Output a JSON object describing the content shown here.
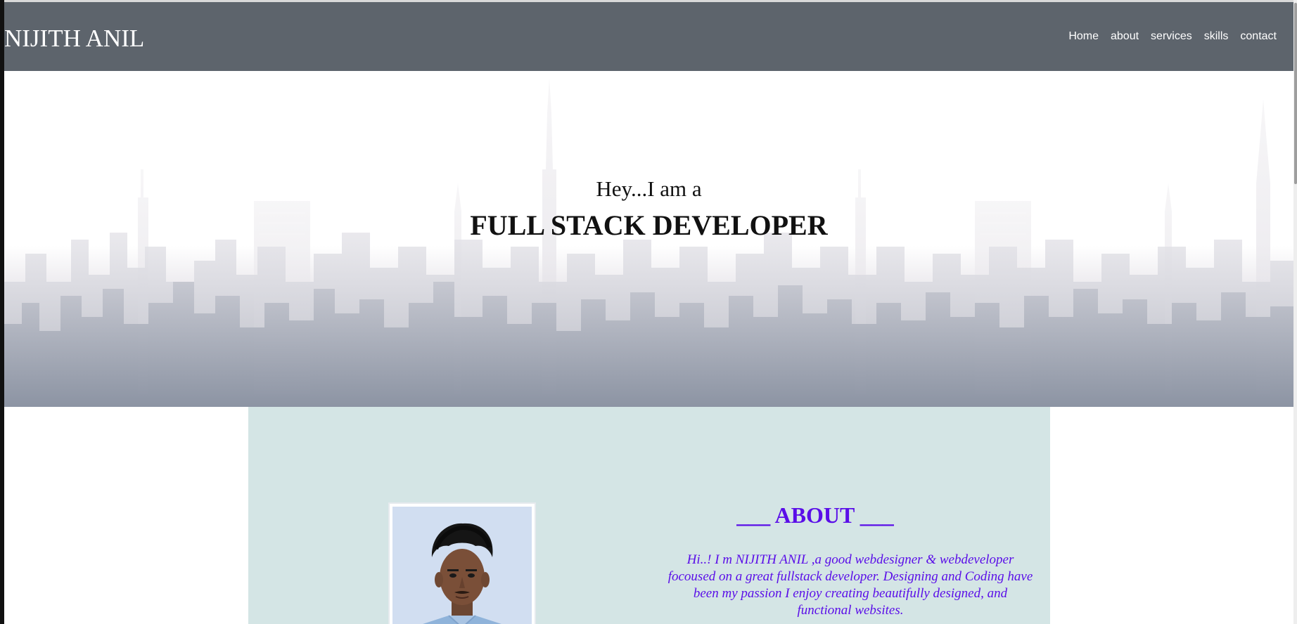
{
  "brand": {
    "name": "NIJITH ANIL"
  },
  "nav": {
    "items": [
      "Home",
      "about",
      "services",
      "skills",
      "contact"
    ]
  },
  "hero": {
    "greeting": "Hey...I am a",
    "role": "FULL STACK DEVELOPER"
  },
  "about": {
    "title": "___ ABOUT ___",
    "text": "Hi..! I m NIJITH ANIL ,a good webdesigner & webdeveloper focoused on a great fullstack developer. Designing and Coding have been my passion I enjoy creating beautifully designed, and functional websites."
  },
  "colors": {
    "navbar": "#5d646c",
    "about_bg": "#d4e5e5",
    "accent": "#5a0ee8"
  }
}
